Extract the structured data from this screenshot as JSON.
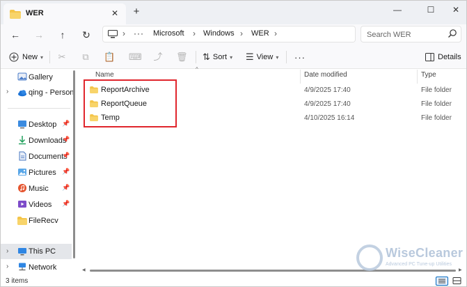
{
  "window": {
    "tab_title": "WER",
    "tab_close": "✕",
    "new_tab": "+",
    "controls": {
      "minimize": "—",
      "maximize": "☐",
      "close": "✕"
    }
  },
  "nav": {
    "back": "←",
    "forward": "→",
    "up": "↑",
    "refresh": "↻",
    "more_locations": "···",
    "breadcrumb": [
      "Microsoft",
      "Windows",
      "WER"
    ],
    "search_placeholder": "Search WER"
  },
  "commands": {
    "new_label": "New",
    "sort_label": "Sort",
    "view_label": "View",
    "more": "···",
    "details_label": "Details"
  },
  "sidebar": {
    "items": [
      {
        "label": "Gallery",
        "icon": "gallery-icon"
      },
      {
        "label": "qing - Personal",
        "icon": "onedrive-icon"
      },
      {
        "label": "Desktop",
        "icon": "desktop-icon",
        "pinned": true
      },
      {
        "label": "Downloads",
        "icon": "downloads-icon",
        "pinned": true
      },
      {
        "label": "Documents",
        "icon": "documents-icon",
        "pinned": true
      },
      {
        "label": "Pictures",
        "icon": "pictures-icon",
        "pinned": true
      },
      {
        "label": "Music",
        "icon": "music-icon",
        "pinned": true
      },
      {
        "label": "Videos",
        "icon": "videos-icon",
        "pinned": true
      },
      {
        "label": "FileRecv",
        "icon": "folder-icon"
      },
      {
        "label": "This PC",
        "icon": "this-pc-icon",
        "selected": true
      },
      {
        "label": "Network",
        "icon": "network-icon"
      }
    ]
  },
  "columns": {
    "name": "Name",
    "date": "Date modified",
    "type": "Type"
  },
  "files": [
    {
      "name": "ReportArchive",
      "date": "4/9/2025 17:40",
      "type": "File folder"
    },
    {
      "name": "ReportQueue",
      "date": "4/9/2025 17:40",
      "type": "File folder"
    },
    {
      "name": "Temp",
      "date": "4/10/2025 16:14",
      "type": "File folder"
    }
  ],
  "status": {
    "item_count": "3 items"
  },
  "watermark": {
    "name": "WiseCleaner",
    "tagline": "Advanced PC Tune-up Utilities"
  },
  "colors": {
    "accent": "#0067c0",
    "highlight": "#e0252c",
    "folder": "#f4c54a"
  }
}
